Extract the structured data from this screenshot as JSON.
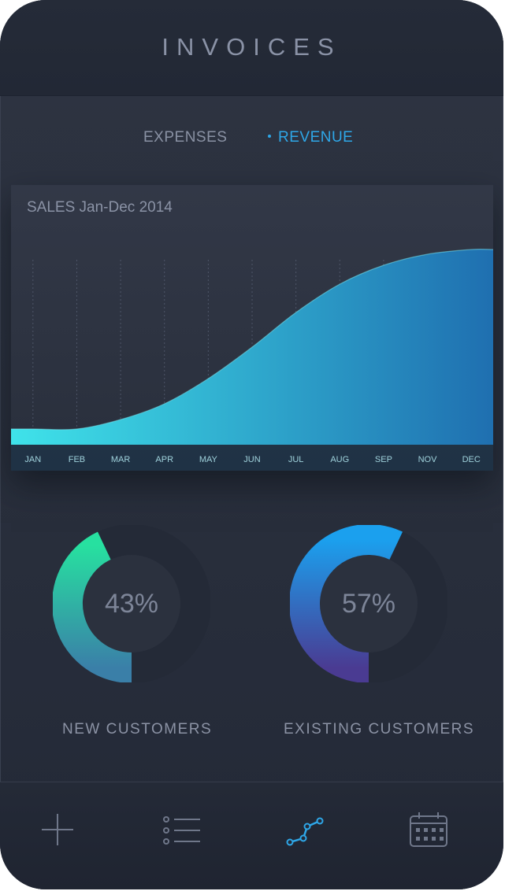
{
  "header": {
    "title": "INVOICES"
  },
  "tabs": [
    {
      "label": "EXPENSES",
      "active": false
    },
    {
      "label": "REVENUE",
      "active": true
    }
  ],
  "chart": {
    "title": "SALES Jan-Dec 2014"
  },
  "chart_data": {
    "type": "area",
    "title": "SALES Jan-Dec 2014",
    "categories": [
      "JAN",
      "FEB",
      "MAR",
      "APR",
      "MAY",
      "JUN",
      "JUL",
      "AUG",
      "SEP",
      "NOV",
      "DEC"
    ],
    "values": [
      5,
      5,
      8,
      13,
      21,
      31,
      42,
      51,
      57,
      60.5,
      62
    ],
    "ylim": [
      0,
      70
    ],
    "xlabel": "",
    "ylabel": "",
    "grid": true,
    "colors": {
      "start": "#3fe3ea",
      "end": "#1f6fb0"
    }
  },
  "stats": [
    {
      "percent": "43%",
      "value": 0.43,
      "label": "NEW CUSTOMERS",
      "colors": [
        "#27e0a0",
        "#3a7fa8"
      ]
    },
    {
      "percent": "57%",
      "value": 0.57,
      "label": "EXISTING CUSTOMERS",
      "colors": [
        "#1ba0ee",
        "#4a3b92"
      ]
    }
  ],
  "nav": [
    {
      "icon": "plus-icon"
    },
    {
      "icon": "list-icon"
    },
    {
      "icon": "chart-line-icon",
      "active": true
    },
    {
      "icon": "calendar-icon"
    }
  ],
  "colors": {
    "accent": "#2ea7e8",
    "text_muted": "#8a92a6",
    "background": "#2b313e"
  }
}
